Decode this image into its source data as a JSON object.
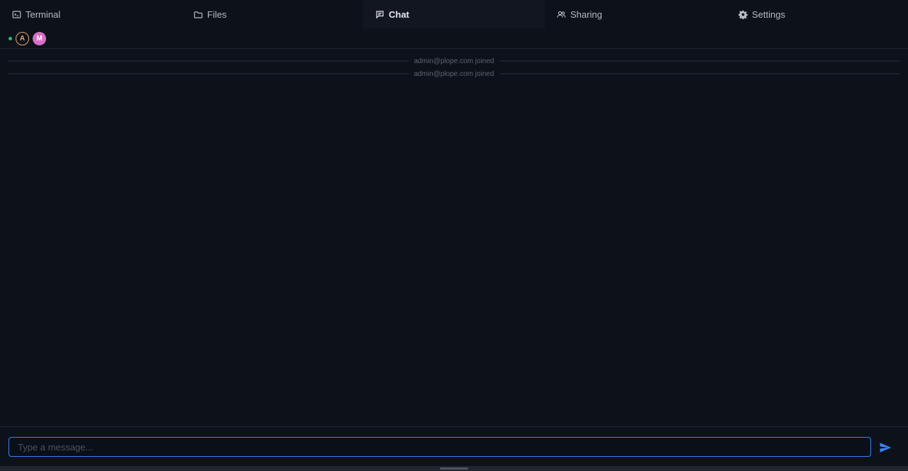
{
  "tabs": [
    {
      "label": "Terminal",
      "icon": "terminal-icon",
      "active": false
    },
    {
      "label": "Files",
      "icon": "folder-icon",
      "active": false
    },
    {
      "label": "Chat",
      "icon": "chat-icon",
      "active": true
    },
    {
      "label": "Sharing",
      "icon": "users-icon",
      "active": false
    },
    {
      "label": "Settings",
      "icon": "gear-icon",
      "active": false
    }
  ],
  "presence": {
    "status": "online",
    "avatars": [
      {
        "initial": "A",
        "color": "#e8a773"
      },
      {
        "initial": "M",
        "color": "#d86fc4"
      }
    ]
  },
  "messages": [
    {
      "type": "system",
      "text": "admin@plope.com joined"
    },
    {
      "type": "system",
      "text": "admin@plope.com joined"
    }
  ],
  "composer": {
    "placeholder": "Type a message...",
    "value": "",
    "send_icon": "send-icon"
  },
  "colors": {
    "background": "#0d1119",
    "active_tab": "#111620",
    "accent": "#3b82f6",
    "online": "#22c55e"
  }
}
